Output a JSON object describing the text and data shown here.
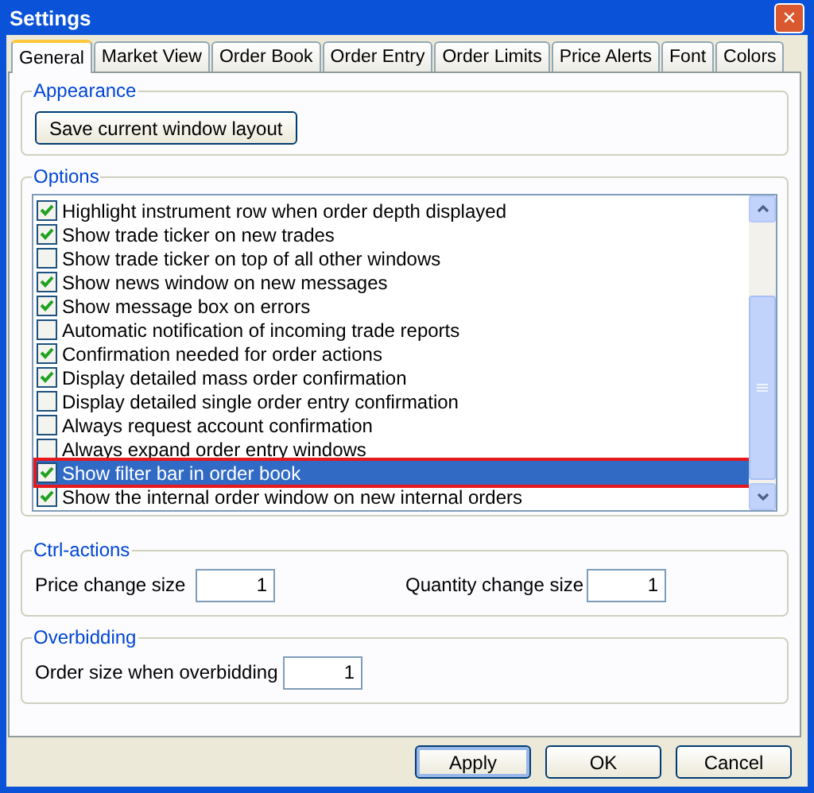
{
  "window": {
    "title": "Settings",
    "close": "✕"
  },
  "tabs": [
    {
      "label": "General",
      "selected": true
    },
    {
      "label": "Market View",
      "selected": false
    },
    {
      "label": "Order Book",
      "selected": false
    },
    {
      "label": "Order Entry",
      "selected": false
    },
    {
      "label": "Order Limits",
      "selected": false
    },
    {
      "label": "Price Alerts",
      "selected": false
    },
    {
      "label": "Font",
      "selected": false
    },
    {
      "label": "Colors",
      "selected": false
    }
  ],
  "appearance": {
    "legend": "Appearance",
    "button": "Save current window layout"
  },
  "options": {
    "legend": "Options",
    "items": [
      {
        "label": "Highlight instrument row when order depth displayed",
        "checked": true,
        "selected": false
      },
      {
        "label": "Show trade ticker on new trades",
        "checked": true,
        "selected": false
      },
      {
        "label": "Show trade ticker on top of all other windows",
        "checked": false,
        "selected": false
      },
      {
        "label": "Show news window on new messages",
        "checked": true,
        "selected": false
      },
      {
        "label": "Show message box on errors",
        "checked": true,
        "selected": false
      },
      {
        "label": "Automatic notification of incoming trade reports",
        "checked": false,
        "selected": false
      },
      {
        "label": "Confirmation needed for order actions",
        "checked": true,
        "selected": false
      },
      {
        "label": "Display detailed mass order confirmation",
        "checked": true,
        "selected": false
      },
      {
        "label": "Display detailed single order entry confirmation",
        "checked": false,
        "selected": false
      },
      {
        "label": "Always request account confirmation",
        "checked": false,
        "selected": false
      },
      {
        "label": "Always expand order entry windows",
        "checked": false,
        "selected": false
      },
      {
        "label": "Show filter bar in order book",
        "checked": true,
        "selected": true
      },
      {
        "label": "Show the internal order window on new internal orders",
        "checked": true,
        "selected": false
      }
    ]
  },
  "ctrl_actions": {
    "legend": "Ctrl-actions",
    "fields": [
      {
        "label": "Price change size",
        "value": "1"
      },
      {
        "label": "Quantity change size",
        "value": "1"
      }
    ]
  },
  "overbidding": {
    "legend": "Overbidding",
    "fields": [
      {
        "label": "Order size when overbidding",
        "value": "1"
      }
    ]
  },
  "buttons": [
    {
      "label": "Apply",
      "default": true
    },
    {
      "label": "OK",
      "default": false
    },
    {
      "label": "Cancel",
      "default": false
    }
  ]
}
